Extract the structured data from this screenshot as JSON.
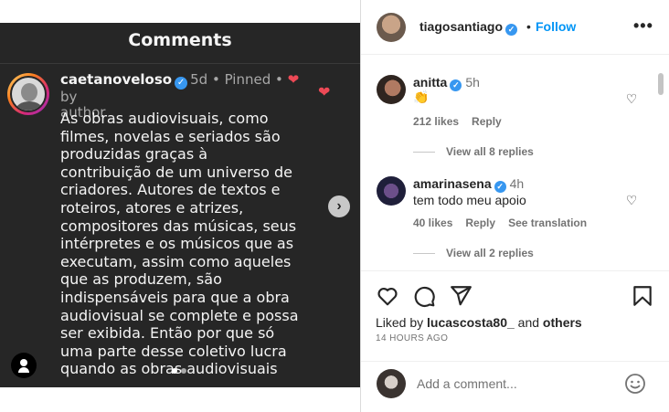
{
  "post_media": {
    "title": "Comments",
    "comment_user": "caetanoveloso",
    "comment_time": "5d",
    "comment_pinned": "Pinned",
    "comment_by": "by",
    "comment_author": "author",
    "comment_lines": [
      "As obras audiovisuais, como",
      "filmes, novelas e seriados são",
      "produzidas graças à",
      "contribuição de um universo de",
      "criadores. Autores de textos e",
      "roteiros, atores e atrizes,",
      "compositores das músicas, seus",
      "intérpretes e os músicos que as",
      "executam, assim como aqueles",
      "que as produzem, são",
      "indispensáveis para que a obra",
      "audiovisual se complete e possa",
      "ser exibida. Então por que só",
      "uma parte desse coletivo lucra",
      "quando as obras audiovisuais"
    ],
    "next_icon": "chevron-right-icon",
    "user_tag_icon": "person-icon"
  },
  "header": {
    "username": "tiagosantiago",
    "separator": "•",
    "follow_label": "Follow",
    "more_label": "•••"
  },
  "comments": [
    {
      "username": "anitta",
      "time": "5h",
      "text": "👏",
      "likes": "212 likes",
      "reply": "Reply",
      "view_replies": "View all 8 replies"
    },
    {
      "username": "amarinasena",
      "time": "4h",
      "text": "tem todo meu apoio",
      "likes": "40 likes",
      "reply": "Reply",
      "translation": "See translation",
      "view_replies": "View all 2 replies"
    }
  ],
  "footer": {
    "liked_by_prefix": "Liked by",
    "liked_by_user": "lucascosta80_",
    "liked_by_and": "and",
    "liked_by_others": "others",
    "time_ago": "14 HOURS AGO",
    "comment_placeholder": "Add a comment..."
  },
  "colors": {
    "accent": "#0095f6",
    "verified": "#3797f0",
    "like_red": "#ed4956",
    "media_bg": "#262626"
  }
}
